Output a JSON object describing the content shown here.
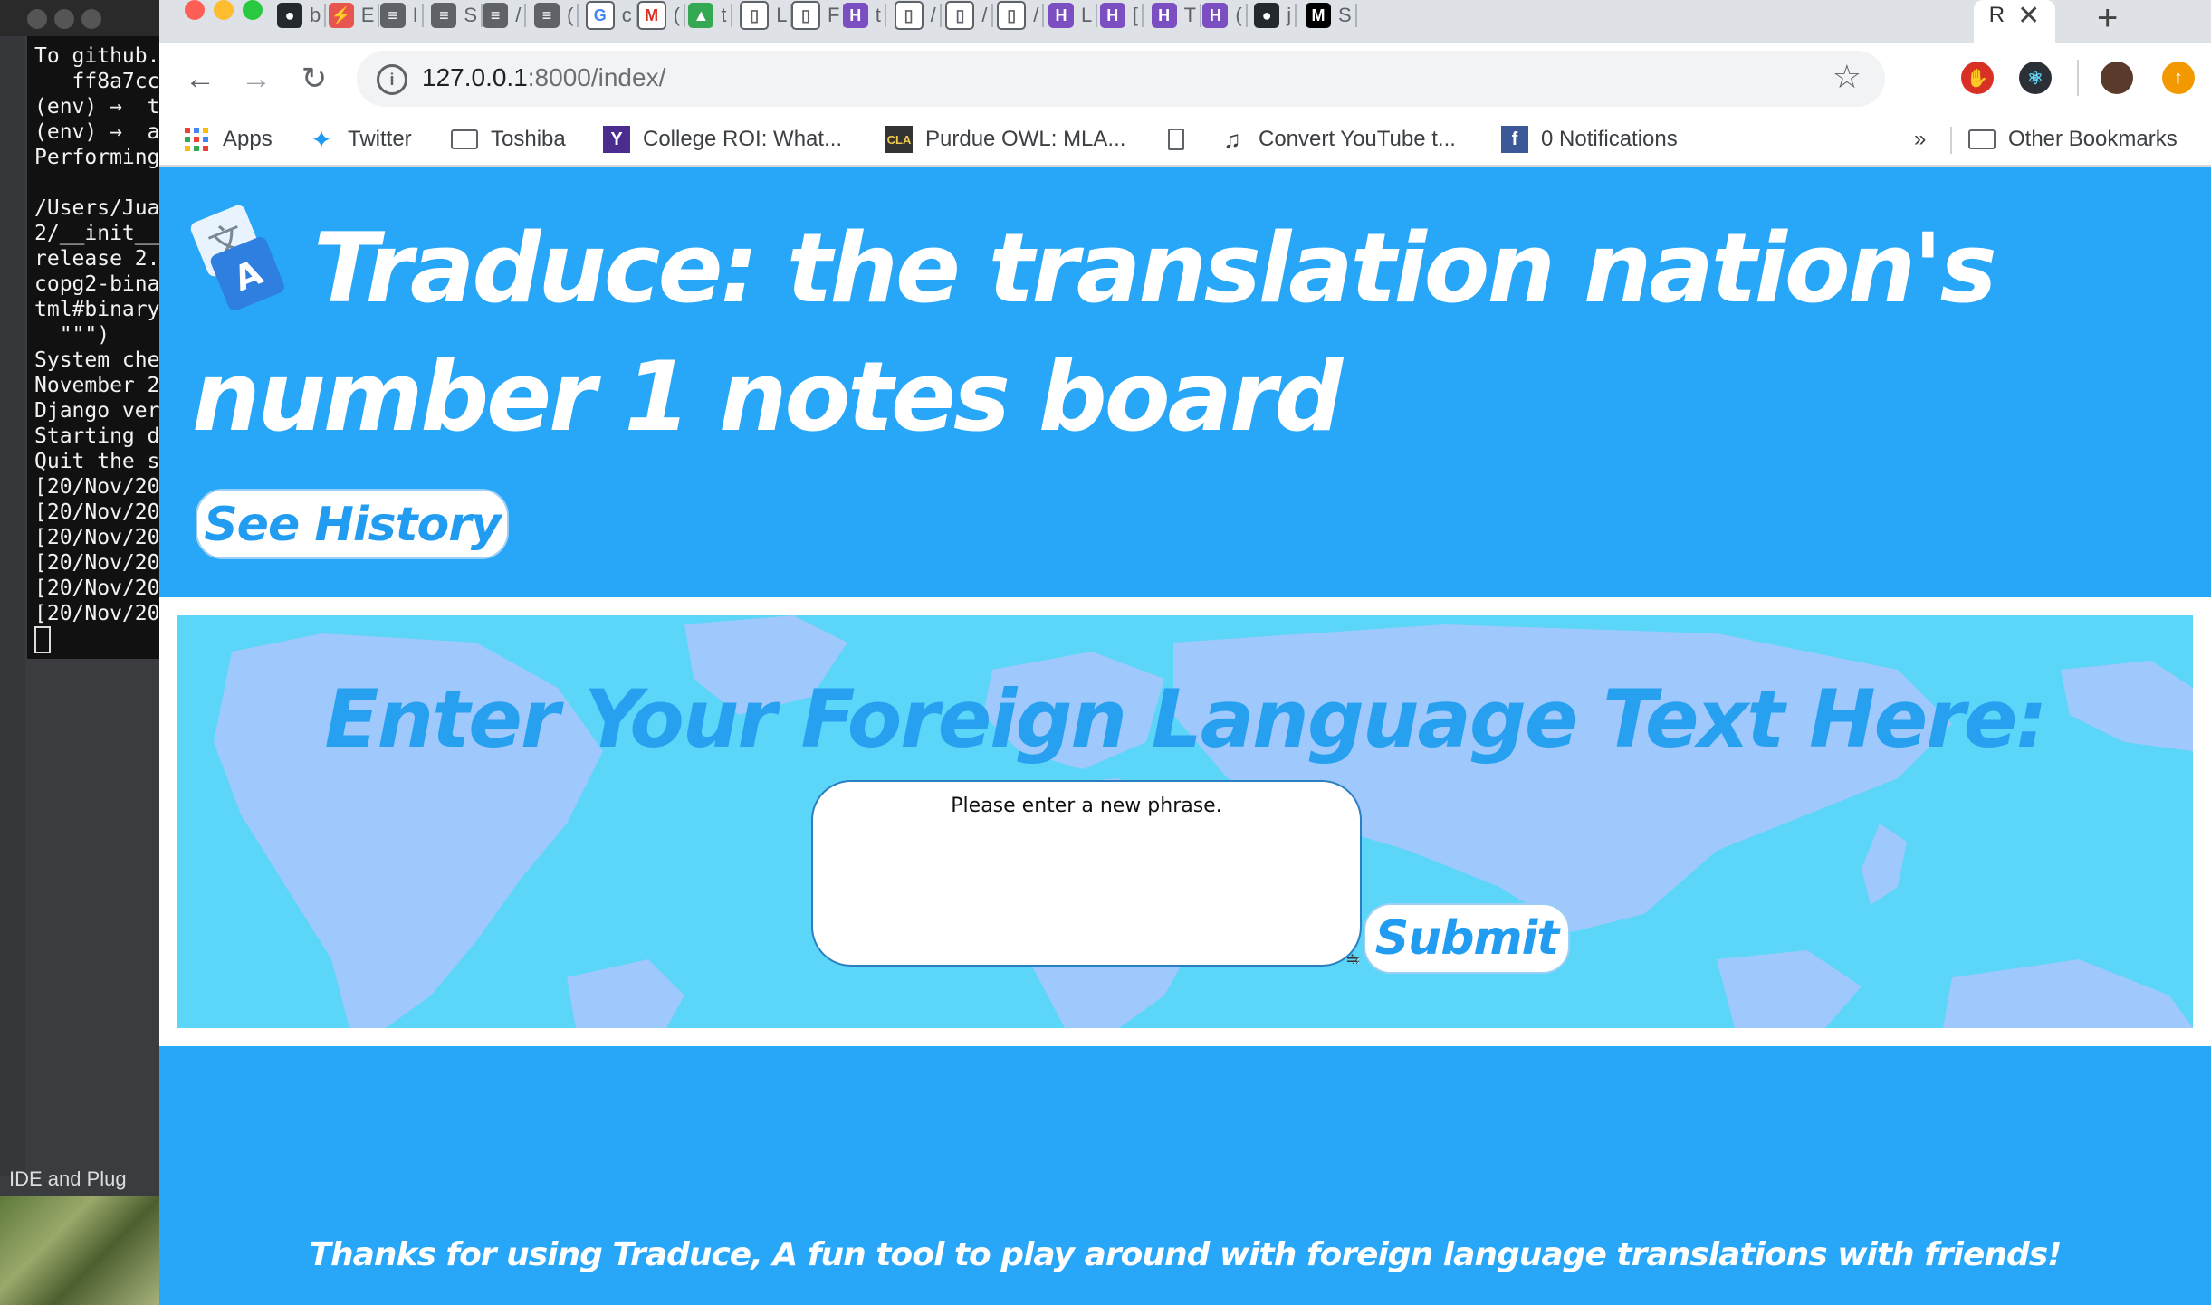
{
  "terminal": {
    "lines": [
      "To github.",
      "   ff8a7cc",
      "(env) →  t",
      "(env) →  a",
      "Performing",
      "",
      "/Users/Jua",
      "2/__init__",
      "release 2.",
      "copg2-bina",
      "tml#binary",
      "  \"\"\")",
      "System che",
      "November 2",
      "Django ver",
      "Starting d",
      "Quit the s",
      "[20/Nov/20",
      "[20/Nov/20",
      "[20/Nov/20",
      "[20/Nov/20",
      "[20/Nov/20",
      "[20/Nov/20"
    ],
    "ide_label": "IDE and Plug"
  },
  "browser": {
    "tabs": [
      {
        "icon": "github-icon",
        "label": "b"
      },
      {
        "icon": "shield-icon",
        "label": "E"
      },
      {
        "icon": "doc-icon",
        "label": "I"
      },
      {
        "icon": "doc-icon",
        "label": "S"
      },
      {
        "icon": "doc-icon",
        "label": "/"
      },
      {
        "icon": "doc-icon",
        "label": "("
      },
      {
        "icon": "google-icon",
        "label": "c"
      },
      {
        "icon": "gmail-icon",
        "label": "("
      },
      {
        "icon": "drive-icon",
        "label": "t"
      },
      {
        "icon": "page-icon",
        "label": "L"
      },
      {
        "icon": "page-icon",
        "label": "F"
      },
      {
        "icon": "h-icon",
        "label": "t"
      },
      {
        "icon": "page-icon",
        "label": "/"
      },
      {
        "icon": "page-icon",
        "label": "/"
      },
      {
        "icon": "page-icon",
        "label": "/"
      },
      {
        "icon": "h-icon",
        "label": "L"
      },
      {
        "icon": "h-icon",
        "label": "["
      },
      {
        "icon": "h-icon",
        "label": "T"
      },
      {
        "icon": "h-icon",
        "label": "("
      },
      {
        "icon": "github-icon",
        "label": "j"
      },
      {
        "icon": "medium-icon",
        "label": "S"
      }
    ],
    "active_tab": {
      "label": "R",
      "close": "✕"
    },
    "new_tab": "+",
    "url_host": "127.0.0.1",
    "url_path": ":8000/index/",
    "bookmarks": {
      "apps": "Apps",
      "twitter": "Twitter",
      "toshiba": "Toshiba",
      "college_roi": "College ROI: What...",
      "purdue": "Purdue OWL: MLA...",
      "convert_youtube": "Convert YouTube t...",
      "notifications": "0 Notifications",
      "overflow": "»",
      "other": "Other Bookmarks"
    }
  },
  "page": {
    "title": "Traduce: the translation nation's number 1 notes board",
    "history_button": "See History",
    "prompt_heading": "Enter Your Foreign Language Text Here:",
    "input_placeholder": "Please enter a new phrase.",
    "submit_button": "Submit",
    "footer": "Thanks for using Traduce, A fun tool to play around with foreign language translations with friends!"
  },
  "colors": {
    "brand_blue": "#28a6f7",
    "map_water": "#5bd5f8",
    "map_land": "#9fc8fc",
    "heading_blue": "#27a0f0"
  }
}
